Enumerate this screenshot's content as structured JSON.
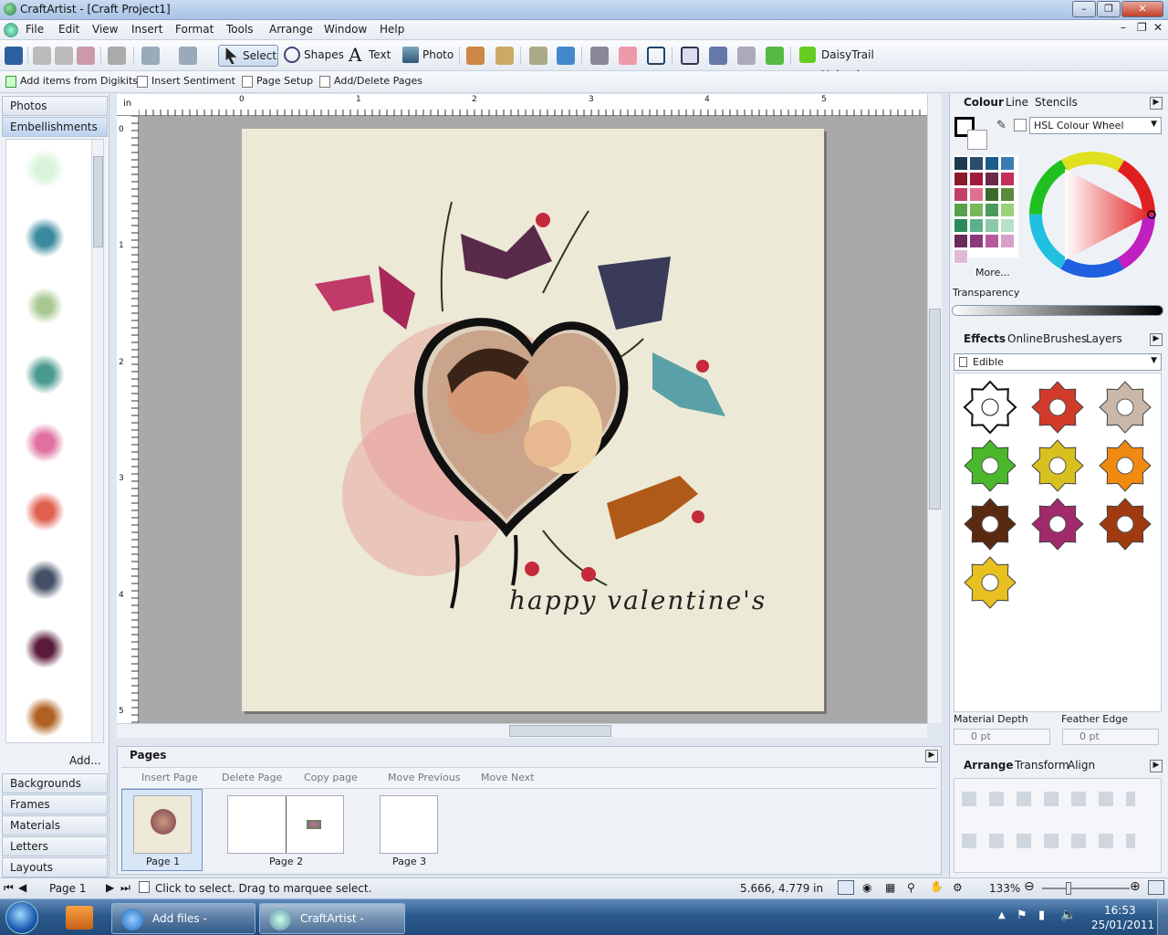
{
  "window": {
    "title": "CraftArtist - [Craft Project1]",
    "min": "–",
    "restore": "❐",
    "close": "✕"
  },
  "menu": [
    "File",
    "Edit",
    "View",
    "Insert",
    "Format",
    "Tools",
    "Arrange",
    "Window",
    "Help"
  ],
  "toolbar": {
    "select": "Select",
    "shapes": "Shapes",
    "text": "Text",
    "photo": "Photo",
    "daisytrail": "DaisyTrail Upload"
  },
  "toolbar2": {
    "add_items": "Add items from Digikits",
    "insert_sentiment": "Insert Sentiment",
    "page_setup": "Page Setup",
    "add_delete_pages": "Add/Delete Pages"
  },
  "left_panel": {
    "tabs_top": [
      "Photos",
      "Embellishments"
    ],
    "add_label": "Add...",
    "tabs_bottom": [
      "Backgrounds",
      "Frames",
      "Materials",
      "Letters",
      "Layouts"
    ]
  },
  "ruler": {
    "unit": "in",
    "h_ticks": [
      "0",
      "1",
      "2",
      "3",
      "4",
      "5"
    ],
    "v_ticks": [
      "0",
      "1",
      "2",
      "3",
      "4",
      "5"
    ]
  },
  "canvas": {
    "caption": "happy valentine's"
  },
  "colour_panel": {
    "tabs": [
      "Colour",
      "Line",
      "Stencils"
    ],
    "mode": "HSL Colour Wheel",
    "more": "More...",
    "transparency": "Transparency",
    "swatches": [
      "#1f3a4d",
      "#2a4c6a",
      "#1c5b8c",
      "#3a7cb2",
      "#8a1a2a",
      "#a01c3c",
      "#6a2a4a",
      "#c0305a",
      "#c0406a",
      "#e07090",
      "#3a6a2a",
      "#5a8a3a",
      "#5aa04a",
      "#78b85a",
      "#4a9a5a",
      "#9ad07a",
      "#2a8a5a",
      "#5ab08a",
      "#8ac8a8",
      "#b8e0c8",
      "#6a2a5a",
      "#8a3a7a",
      "#b85a9a",
      "#d8a0c8",
      "#e0b8d8"
    ]
  },
  "effects_panel": {
    "tabs": [
      "Effects",
      "Online",
      "Brushes",
      "Layers"
    ],
    "category": "Edible",
    "material_depth_label": "Material Depth",
    "material_depth_value": "0 pt",
    "feather_edge_label": "Feather Edge",
    "feather_edge_value": "0 pt",
    "gear_colors": [
      "#ffffff",
      "#d23a2a",
      "#c9b8a8",
      "#4ab82a",
      "#d8c020",
      "#f08a10",
      "#5a2a10",
      "#a02a6a",
      "#a03a10",
      "#e8c020"
    ]
  },
  "arrange_panel": {
    "tabs": [
      "Arrange",
      "Transform",
      "Align"
    ]
  },
  "pages_panel": {
    "title": "Pages",
    "actions": [
      "Insert Page",
      "Delete Page",
      "Copy page",
      "Move Previous",
      "Move Next"
    ],
    "pages": [
      "Page 1",
      "Page 2",
      "Page 3"
    ]
  },
  "status": {
    "page": "Page 1",
    "hint": "Click to select. Drag to marquee select.",
    "coords": "5.666,  4.779 in",
    "zoom": "133%"
  },
  "taskbar": {
    "items": [
      "Add files - Windo...",
      "CraftArtist - [Craft..."
    ],
    "time": "16:53",
    "date": "25/01/2011"
  }
}
